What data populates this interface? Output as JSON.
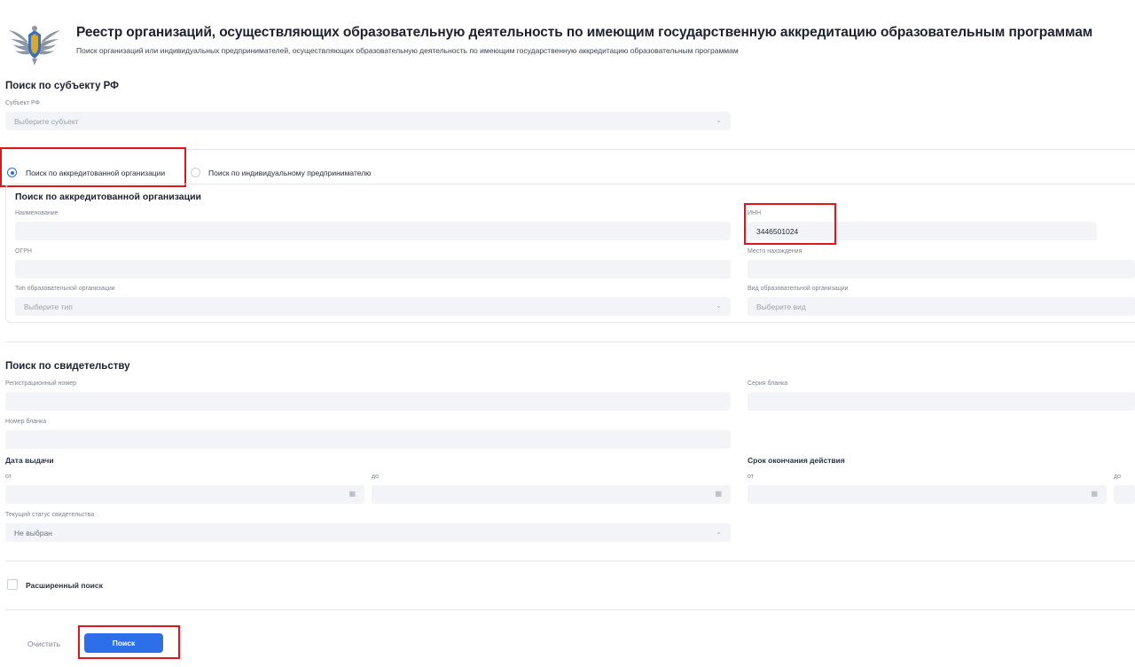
{
  "header": {
    "title": "Реестр организаций, осуществляющих образовательную деятельность по имеющим государственную аккредитацию образовательным программам",
    "subtitle": "Поиск организаций или индивидуальных предпринимателей, осуществляющих образовательную деятельность по имеющим государственную аккредитацию образовательным программам"
  },
  "subject_search": {
    "title": "Поиск по субъекту РФ",
    "label": "Субъект РФ",
    "placeholder": "Выберите субъект"
  },
  "mode": {
    "options": [
      {
        "label": "Поиск по аккредитованной организации",
        "selected": true
      },
      {
        "label": "Поиск по индивидуальному предпринимателю",
        "selected": false
      }
    ]
  },
  "org_search": {
    "title": "Поиск по аккредитованной организации",
    "name_label": "Наименование",
    "name_value": "",
    "inn_label": "ИНН",
    "inn_value": "3446501024",
    "ogrn_label": "ОГРН",
    "ogrn_value": "",
    "location_label": "Место нахождения",
    "location_value": "",
    "type_label": "Тип образовательной организации",
    "type_placeholder": "Выберите тип",
    "kind_label": "Вид образовательной организации",
    "kind_placeholder": "Выберите вид"
  },
  "certificate_search": {
    "title": "Поиск по свидетельству",
    "reg_number_label": "Регистрационный номер",
    "blank_series_label": "Серия бланка",
    "blank_number_label": "Номер бланка",
    "issue_date_title": "Дата выдачи",
    "expiry_title": "Срок окончания действия",
    "from_label": "от",
    "to_label": "до",
    "status_label": "Текущий статус свидетельства",
    "status_value": "Не выбран"
  },
  "advanced": {
    "label": "Расширенный поиск",
    "checked": false
  },
  "actions": {
    "clear_label": "Очистить",
    "search_label": "Поиск"
  },
  "colors": {
    "accent": "#2d6fe8",
    "highlight": "#e3141a",
    "field_bg": "#f2f4f7"
  }
}
